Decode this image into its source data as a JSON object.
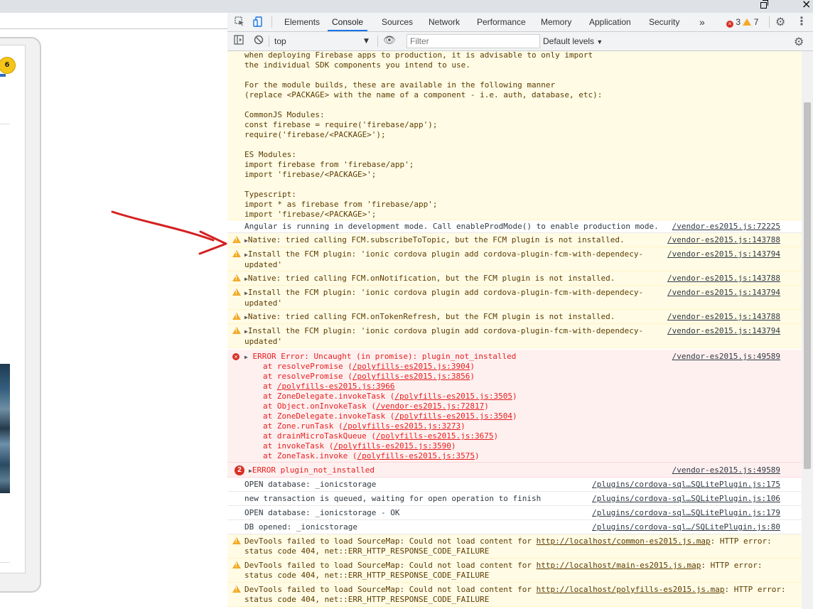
{
  "devtools": {
    "tabs": [
      "Elements",
      "Console",
      "Sources",
      "Network",
      "Performance",
      "Memory",
      "Application",
      "Security"
    ],
    "more_tabs": "»",
    "error_count": "3",
    "warning_count": "7"
  },
  "toolbar": {
    "context": "top",
    "filter_placeholder": "Filter",
    "levels": "Default levels"
  },
  "page": {
    "badge_count": "6"
  },
  "console": {
    "firebase_lines": [
      "when deploying Firebase apps to production, it is advisable to only import",
      "the individual SDK components you intend to use.",
      "",
      "For the module builds, these are available in the following manner",
      "(replace <PACKAGE> with the name of a component - i.e. auth, database, etc):",
      "",
      "CommonJS Modules:",
      "const firebase = require('firebase/app');",
      "require('firebase/<PACKAGE>');",
      "",
      "ES Modules:",
      "import firebase from 'firebase/app';",
      "import 'firebase/<PACKAGE>';",
      "",
      "Typescript:",
      "import * as firebase from 'firebase/app';",
      "import 'firebase/<PACKAGE>';"
    ],
    "angular": {
      "text": "Angular is running in development mode. Call enableProdMode() to enable production mode.",
      "src": "/vendor-es2015.js:72225"
    },
    "warnings1": [
      {
        "line1": "Native: tried calling FCM.subscribeToTopic, but the FCM plugin is not installed.",
        "line2": "",
        "src": "/vendor-es2015.js:143788"
      },
      {
        "line1": "Install the FCM plugin: 'ionic cordova plugin add cordova-plugin-fcm-with-dependecy-",
        "line2": "updated'",
        "src": "/vendor-es2015.js:143794"
      },
      {
        "line1": "Native: tried calling FCM.onNotification, but the FCM plugin is not installed.",
        "line2": "",
        "src": "/vendor-es2015.js:143788"
      },
      {
        "line1": "Install the FCM plugin: 'ionic cordova plugin add cordova-plugin-fcm-with-dependecy-",
        "line2": "updated'",
        "src": "/vendor-es2015.js:143794"
      },
      {
        "line1": "Native: tried calling FCM.onTokenRefresh, but the FCM plugin is not installed.",
        "line2": "",
        "src": "/vendor-es2015.js:143788"
      },
      {
        "line1": "Install the FCM plugin: 'ionic cordova plugin add cordova-plugin-fcm-with-dependecy-",
        "line2": "updated'",
        "src": "/vendor-es2015.js:143794"
      }
    ],
    "error1": {
      "text": "ERROR Error: Uncaught (in promise): plugin_not_installed",
      "src": "/vendor-es2015.js:49589",
      "stack": [
        {
          "fn": "at resolvePromise (",
          "link": "/polyfills-es2015.js:3904",
          "end": ")"
        },
        {
          "fn": "at resolvePromise (",
          "link": "/polyfills-es2015.js:3856",
          "end": ")"
        },
        {
          "fn": "at ",
          "link": "/polyfills-es2015.js:3966",
          "end": ""
        },
        {
          "fn": "at ZoneDelegate.invokeTask (",
          "link": "/polyfills-es2015.js:3505",
          "end": ")"
        },
        {
          "fn": "at Object.onInvokeTask (",
          "link": "/vendor-es2015.js:72817",
          "end": ")"
        },
        {
          "fn": "at ZoneDelegate.invokeTask (",
          "link": "/polyfills-es2015.js:3504",
          "end": ")"
        },
        {
          "fn": "at Zone.runTask (",
          "link": "/polyfills-es2015.js:3273",
          "end": ")"
        },
        {
          "fn": "at drainMicroTaskQueue (",
          "link": "/polyfills-es2015.js:3675",
          "end": ")"
        },
        {
          "fn": "at invokeTask (",
          "link": "/polyfills-es2015.js:3590",
          "end": ")"
        },
        {
          "fn": "at ZoneTask.invoke (",
          "link": "/polyfills-es2015.js:3575",
          "end": ")"
        }
      ]
    },
    "error2": {
      "count": "2",
      "text": "ERROR plugin_not_installed",
      "src": "/vendor-es2015.js:49589"
    },
    "info": [
      {
        "text": "OPEN database: _ionicstorage",
        "src": "/plugins/cordova-sql…SQLitePlugin.js:175"
      },
      {
        "text": "new transaction is queued, waiting for open operation to finish",
        "src": "/plugins/cordova-sql…SQLitePlugin.js:106"
      },
      {
        "text": "OPEN database: _ionicstorage - OK",
        "src": "/plugins/cordova-sql…SQLitePlugin.js:179"
      },
      {
        "text": "DB opened: _ionicstorage",
        "src": "/plugins/cordova-sql…/SQLitePlugin.js:80"
      }
    ],
    "sourcemaps": [
      {
        "pre": "DevTools failed to load SourceMap: Could not load content for ",
        "url": "http://localhost/common-es2015.js.map",
        "post": ": HTTP error:",
        "line2": "status code 404, net::ERR_HTTP_RESPONSE_CODE_FAILURE"
      },
      {
        "pre": "DevTools failed to load SourceMap: Could not load content for ",
        "url": "http://localhost/main-es2015.js.map",
        "post": ": HTTP error:",
        "line2": "status code 404, net::ERR_HTTP_RESPONSE_CODE_FAILURE"
      },
      {
        "pre": "DevTools failed to load SourceMap: Could not load content for ",
        "url": "http://localhost/polyfills-es2015.js.map",
        "post": ": HTTP error:",
        "line2": "status code 404, net::ERR_HTTP_RESPONSE_CODE_FAILURE"
      }
    ]
  },
  "colors": {
    "accent": "#1a73e8",
    "error": "#d93025",
    "warning": "#f2ab26",
    "annotation": "#d42020"
  }
}
